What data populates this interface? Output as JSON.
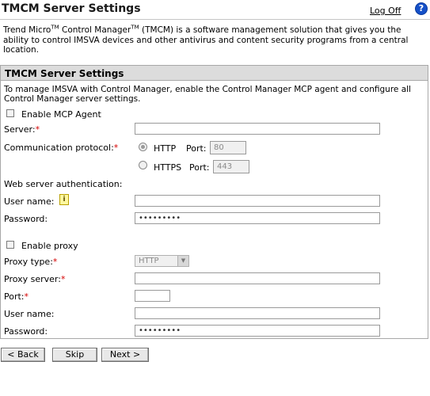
{
  "header": {
    "title": "TMCM Server Settings",
    "logoff_label": "Log Off",
    "help_glyph": "?"
  },
  "intro": {
    "part1": "Trend Micro",
    "tm1": "TM",
    "part2": " Control Manager",
    "tm2": "TM",
    "part3": " (TMCM) is a software management solution that gives you the ability to control IMSVA devices and other antivirus and content security programs from a central location."
  },
  "panel": {
    "title": "TMCM Server Settings",
    "description": "To manage IMSVA with Control Manager, enable the Control Manager MCP agent and configure all Control Manager server settings."
  },
  "form": {
    "enable_mcp_label": "Enable MCP Agent",
    "server_label": "Server:",
    "server_value": "",
    "protocol_label": "Communication protocol:",
    "http_label": "HTTP",
    "https_label": "HTTPS",
    "port_label": "Port:",
    "http_port": "80",
    "https_port": "443",
    "web_auth_label": "Web server authentication:",
    "username_label": "User name:",
    "username_value": "",
    "password_label": "Password:",
    "password_value": "•••••••••",
    "enable_proxy_label": "Enable proxy",
    "proxy_type_label": "Proxy type:",
    "proxy_type_value": "HTTP",
    "proxy_server_label": "Proxy server:",
    "proxy_server_value": "",
    "proxy_port_label": "Port:",
    "proxy_port_value": "",
    "proxy_username_label": "User name:",
    "proxy_username_value": "",
    "proxy_password_label": "Password:",
    "proxy_password_value": "•••••••••",
    "required_mark": "*"
  },
  "buttons": {
    "back": "< Back",
    "skip": "Skip",
    "next": "Next >"
  },
  "colors": {
    "required": "#d40000",
    "panel_header_bg": "#dcdcdc",
    "help_icon": "#1550c8"
  },
  "icons": {
    "help": "help-icon",
    "info": "info-icon",
    "dropdown": "chevron-down-icon"
  }
}
